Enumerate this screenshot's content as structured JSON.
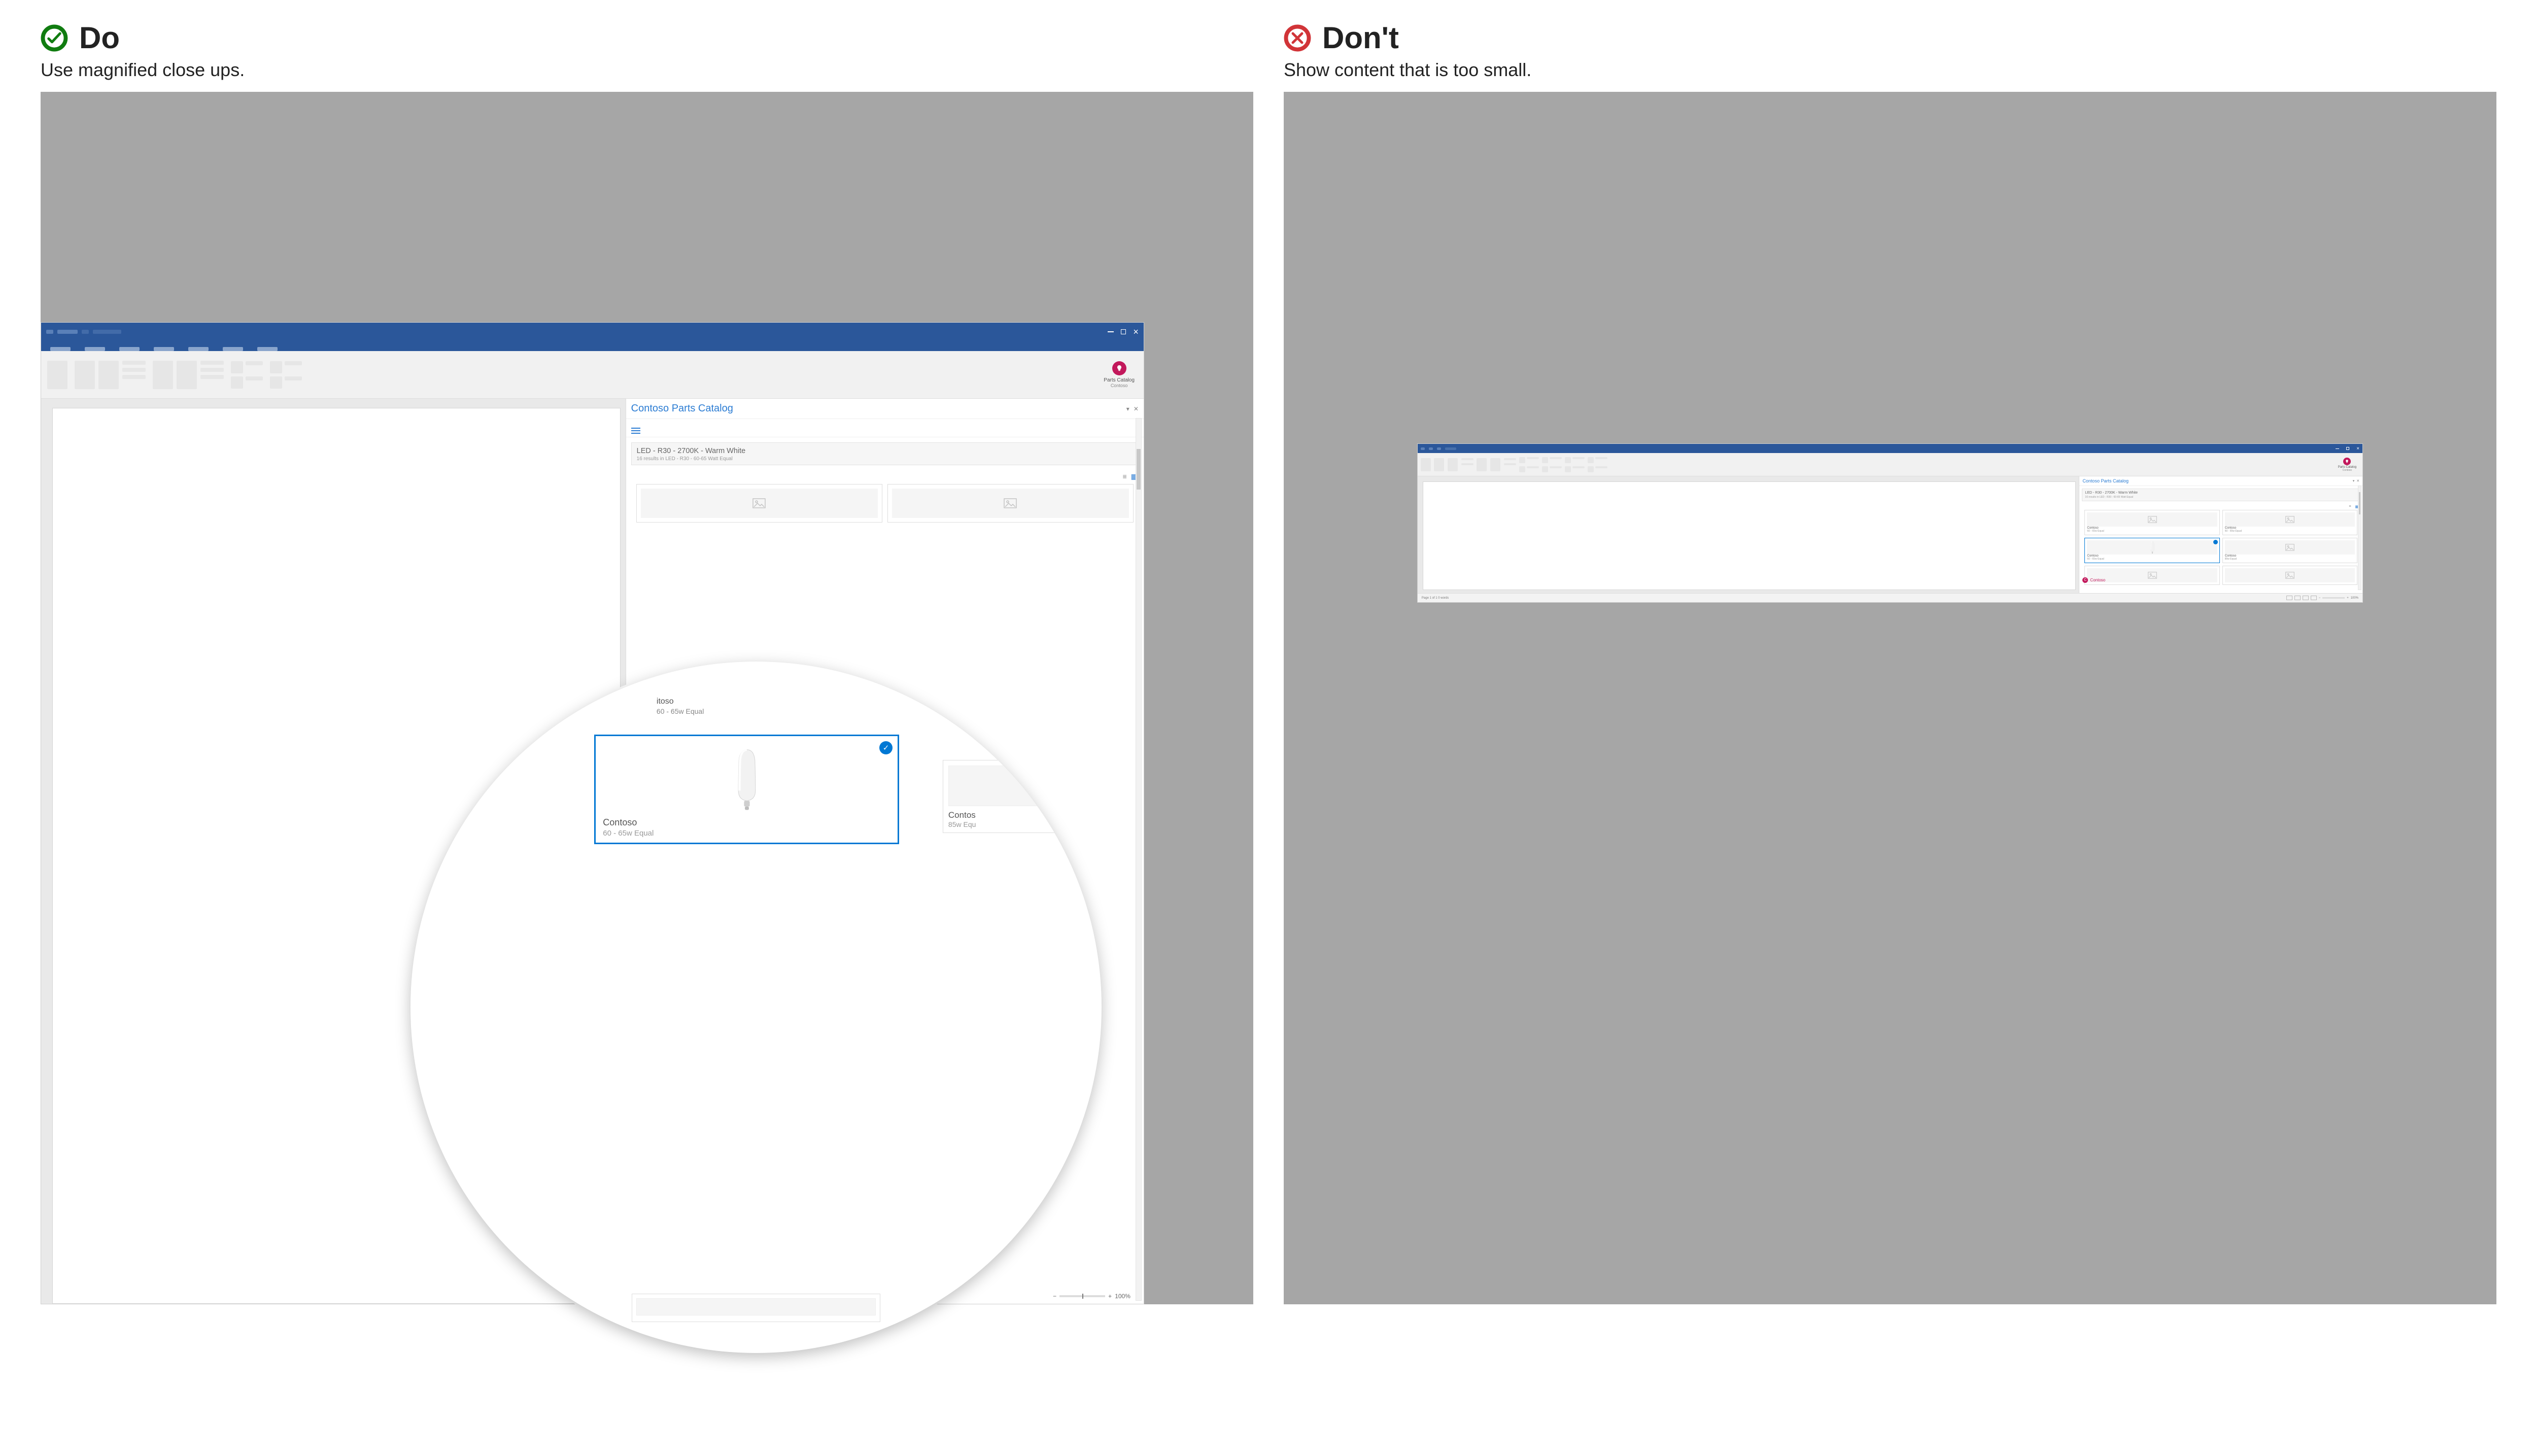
{
  "do": {
    "heading": "Do",
    "subtitle": "Use magnified close ups.",
    "badge_color": "#107c10"
  },
  "dont": {
    "heading": "Don't",
    "subtitle": "Show content that is too small.",
    "badge_color": "#d13438"
  },
  "word": {
    "addin_name": "Parts Catalog",
    "addin_publisher": "Contoso",
    "pane_title": "Contoso Parts Catalog",
    "search_query": "LED - R30 - 2700K - Warm White",
    "search_meta": "16 results in LED - R30 - 60-65 Watt Equal",
    "zoom": "100%",
    "status_left": "Page 1 of 1    0 words",
    "brand": "Contoso"
  },
  "mag": {
    "top_name": "itoso",
    "top_spec": "60 - 65w Equal",
    "card_name": "Contoso",
    "card_spec": "60 - 65w Equal",
    "side_name": "Contos",
    "side_spec": "85w Equ"
  },
  "sm_cards": [
    {
      "name": "Contoso",
      "spec": "60 - 65w Equal",
      "sel": false,
      "img": "ph"
    },
    {
      "name": "Contoso",
      "spec": "60 - 65w Equal",
      "sel": false,
      "img": "ph"
    },
    {
      "name": "Contoso",
      "spec": "60 - 65w Equal",
      "sel": true,
      "img": "bulb"
    },
    {
      "name": "Contoso",
      "spec": "85w Equal",
      "sel": false,
      "img": "ph"
    },
    {
      "name": "",
      "spec": "",
      "sel": false,
      "img": "ph"
    },
    {
      "name": "",
      "spec": "",
      "sel": false,
      "img": "ph"
    }
  ]
}
